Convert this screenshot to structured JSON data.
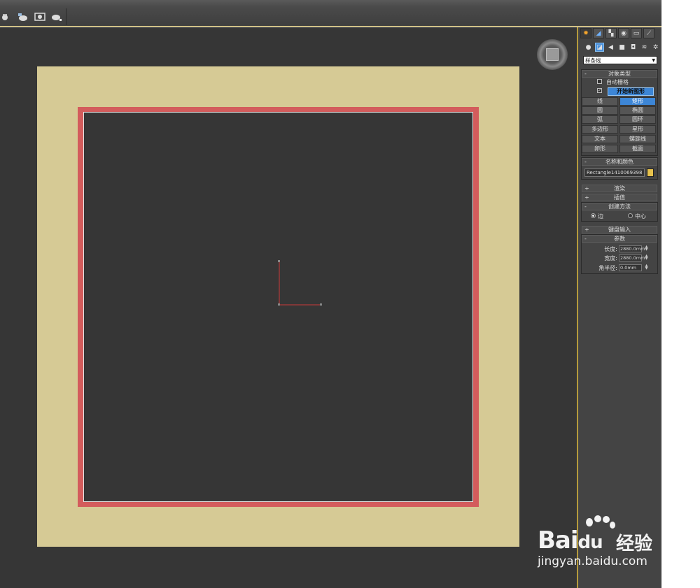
{
  "toolbar": {
    "icons": [
      "teapot-icon",
      "teapot-render-icon",
      "render-frame-icon",
      "quick-render-icon"
    ]
  },
  "viewport": {
    "colors": {
      "background": "#363636",
      "outer_shape": "#d6ca95",
      "selected_shape": "#d35c5c"
    }
  },
  "command_panel": {
    "tabs": [
      "create-icon",
      "modify-icon",
      "hierarchy-icon",
      "motion-icon",
      "display-icon",
      "utilities-icon"
    ],
    "subtabs": [
      "geometry-icon",
      "shapes-icon",
      "lights-icon",
      "cameras-icon",
      "helpers-icon",
      "spacewarps-icon",
      "systems-icon"
    ],
    "category_dropdown": "样条线",
    "object_type": {
      "title": "对象类型",
      "autogrid_label": "自动栅格",
      "start_new_shape_label": "开始新图形",
      "buttons": [
        {
          "label": "线",
          "active": false
        },
        {
          "label": "矩形",
          "active": true
        },
        {
          "label": "圆",
          "active": false
        },
        {
          "label": "椭圆",
          "active": false
        },
        {
          "label": "弧",
          "active": false
        },
        {
          "label": "圆环",
          "active": false
        },
        {
          "label": "多边形",
          "active": false
        },
        {
          "label": "星形",
          "active": false
        },
        {
          "label": "文本",
          "active": false
        },
        {
          "label": "螺旋线",
          "active": false
        },
        {
          "label": "卵形",
          "active": false
        },
        {
          "label": "截面",
          "active": false
        }
      ]
    },
    "name_and_color": {
      "title": "名称和颜色",
      "name_value": "Rectangle1410069398",
      "swatch_color": "#e7c24d"
    },
    "rendering_title": "渲染",
    "interpolation_title": "插值",
    "creation_method": {
      "title": "创建方法",
      "edge_label": "边",
      "center_label": "中心"
    },
    "keyboard_entry_title": "键盘输入",
    "parameters": {
      "title": "参数",
      "length_label": "长度:",
      "length_value": "2880.0mm",
      "width_label": "宽度:",
      "width_value": "2880.0mm",
      "corner_radius_label": "角半径:",
      "corner_radius_value": "0.0mm"
    },
    "collapse_sign": "-",
    "expand_sign": "+"
  },
  "watermark": {
    "brand": "Bai",
    "brand_suffix": "du",
    "chinese": "经验",
    "url": "jingyan.baidu.com"
  }
}
